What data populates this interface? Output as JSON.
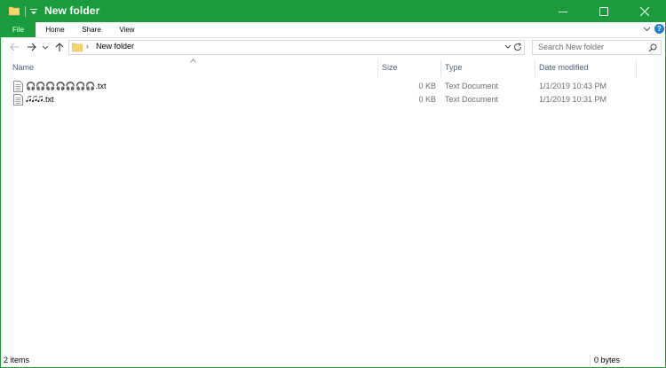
{
  "window": {
    "title": "New folder",
    "accent_color": "#1a9c3c"
  },
  "ribbon": {
    "tabs": [
      {
        "label": "File"
      },
      {
        "label": "Home"
      },
      {
        "label": "Share"
      },
      {
        "label": "View"
      }
    ],
    "help_label": "?"
  },
  "navigation": {
    "address_path": "New folder",
    "search_placeholder": "Search New folder"
  },
  "columns": {
    "name": "Name",
    "size": "Size",
    "type": "Type",
    "date": "Date modified"
  },
  "files": [
    {
      "name": "🎧🎧🎧🎧🎧🎧🎧.txt",
      "size": "0 KB",
      "type": "Text Document",
      "date": "1/1/2019 10:43 PM"
    },
    {
      "name": "🎜🎜🎜.txt",
      "size": "0 KB",
      "type": "Text Document",
      "date": "1/1/2019 10:31 PM"
    }
  ],
  "status": {
    "item_count": "2 items",
    "selection_size": "0 bytes"
  }
}
